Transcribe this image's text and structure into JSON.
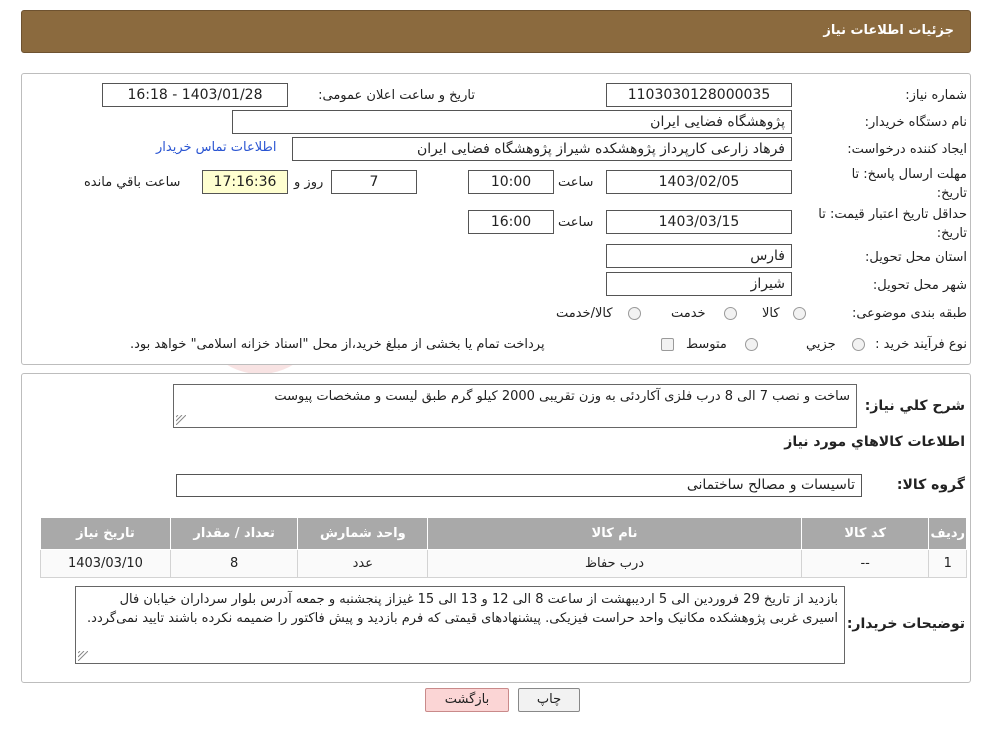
{
  "header": {
    "title": "جزئیات اطلاعات نیاز"
  },
  "form": {
    "need_number_label": "شماره نیاز:",
    "need_number": "1103030128000035",
    "announce_label": "تاریخ و ساعت اعلان عمومی:",
    "announce_value": "1403/01/28 - 16:18",
    "buyer_org_label": "نام دستگاه خریدار:",
    "buyer_org": "پژوهشگاه فضایی ایران",
    "creator_label": "ایجاد کننده درخواست:",
    "creator": "فرهاد زارعی کارپرداز پژوهشکده شیراز پژوهشگاه فضایی ایران",
    "contact_link": "اطلاعات تماس خریدار",
    "deadline_label_1": "مهلت ارسال پاسخ: تا",
    "deadline_label_2": "تاریخ:",
    "deadline_date": "1403/02/05",
    "time_label": "ساعت",
    "deadline_time": "10:00",
    "days_value": "7",
    "days_label": "روز و",
    "remaining_time": "17:16:36",
    "remaining_label": "ساعت باقي مانده",
    "validity_label_1": "حداقل تاریخ اعتبار قیمت: تا",
    "validity_label_2": "تاریخ:",
    "validity_date": "1403/03/15",
    "validity_time": "16:00",
    "province_label": "استان محل تحویل:",
    "province": "فارس",
    "city_label": "شهر محل تحویل:",
    "city": "شیراز",
    "category_label": "طبقه بندی موضوعی:",
    "category_options": [
      "کالا",
      "خدمت",
      "کالا/خدمت"
    ],
    "process_label": "نوع فرآیند خرید :",
    "process_options": [
      "جزیي",
      "متوسط"
    ],
    "payment_note": "پرداخت تمام یا بخشی از مبلغ خرید،از محل \"اسناد خزانه اسلامی\" خواهد بود."
  },
  "description": {
    "label": "شرح کلي نياز:",
    "text": "ساخت و نصب 7 الی 8 درب فلزی آکاردئی به وزن تقریبی 2000 کیلو گرم طبق لیست و مشخصات پیوست"
  },
  "goods": {
    "section_title": "اطلاعات کالاهاي مورد نياز",
    "group_label": "گروه کالا:",
    "group_value": "تاسیسات و مصالح ساختمانی",
    "columns": [
      "ردیف",
      "کد کالا",
      "نام کالا",
      "واحد شمارش",
      "تعداد / مقدار",
      "تاریخ نیاز"
    ],
    "rows": [
      [
        "1",
        "--",
        "درب حفاظ",
        "عدد",
        "8",
        "1403/03/10"
      ]
    ]
  },
  "buyer_notes": {
    "label": "توضیحات خریدار:",
    "text": "بازدید از تاریخ 29 فروردین الی 5 اردیبهشت از ساعت 8 الی 12 و 13 الی 15 غیزاز پنجشنبه و جمعه آدرس بلوار سرداران خیابان فال اسیری غربی پژوهشکده مکانیک واحد حراست فیزیکی. پیشنهادهای قیمتی که فرم بازدید و پیش فاکتور را ضمیمه نکرده باشند تایید نمی‌گردد."
  },
  "buttons": {
    "print": "چاپ",
    "back": "بازگشت"
  },
  "colors": {
    "header_bg": "#8b6a3e",
    "table_header": "#a9a9a9",
    "back_button": "#fbd5d5",
    "link": "#2a55d2"
  }
}
